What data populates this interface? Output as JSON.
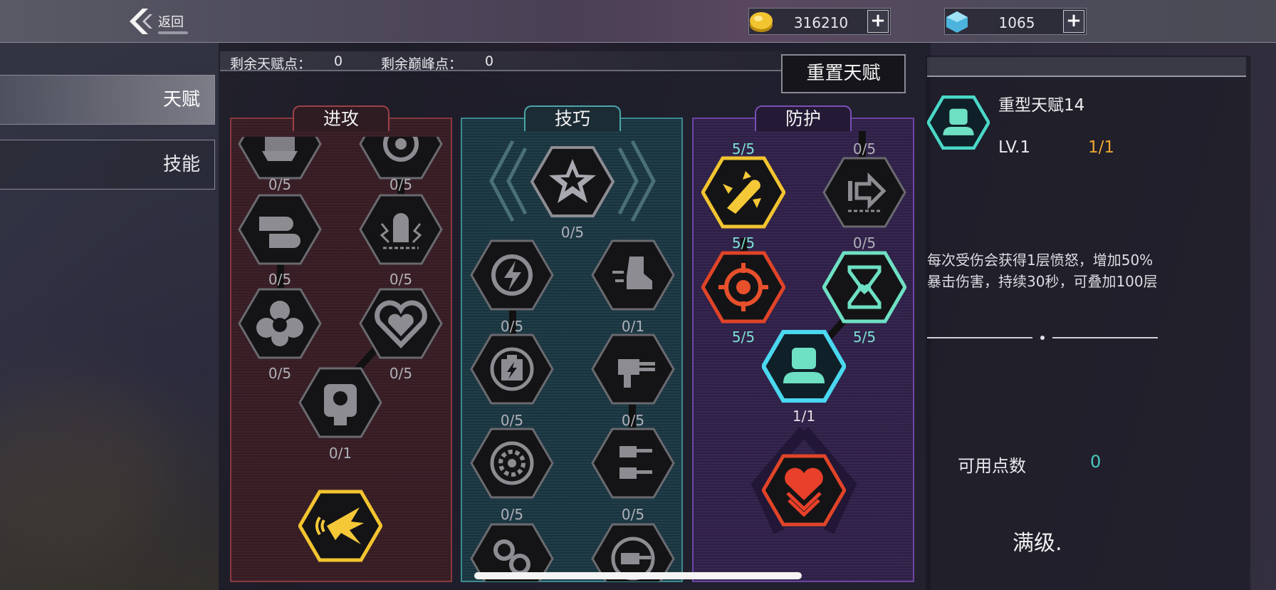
{
  "header": {
    "back_label": "返回",
    "gold": {
      "value": "316210",
      "plus": "+",
      "icon": "gold-coin-icon"
    },
    "gems": {
      "value": "1065",
      "plus": "+",
      "icon": "blue-gem-icon"
    }
  },
  "nav": {
    "items": [
      {
        "label": "天赋",
        "selected": true
      },
      {
        "label": "技能",
        "selected": false
      }
    ]
  },
  "points": {
    "talent_label": "剩余天赋点：",
    "talent_value": "0",
    "peak_label": "剩余巅峰点：",
    "peak_value": "0"
  },
  "reset_label": "重置天赋",
  "panels": {
    "attack": {
      "title": "进攻",
      "counts": [
        "0/5",
        "0/5",
        "0/5",
        "0/5",
        "0/5",
        "0/5",
        "0/1"
      ],
      "icons": [
        "rocket-pod-icon",
        "wheel-turret-icon",
        "twin-bullet-icon",
        "lightning-bullet-icon",
        "leaf-cluster-icon",
        "heart-shield-icon",
        "target-scope-icon",
        "burst-blast-icon"
      ]
    },
    "skill": {
      "title": "技巧",
      "counts": [
        "0/5",
        "0/5",
        "0/1",
        "0/5",
        "0/5",
        "0/5",
        "0/5"
      ],
      "icons": [
        "star-icon",
        "lightning-refresh-icon",
        "dash-boot-icon",
        "battery-refresh-icon",
        "gatling-gun-icon",
        "gear-shield-icon",
        "twin-cannon-icon",
        "gear-cluster-icon",
        "cannon-refresh-icon"
      ]
    },
    "defense": {
      "title": "防护",
      "counts": [
        "5/5",
        "0/5",
        "5/5",
        "0/5",
        "5/5",
        "5/5",
        "1/1"
      ],
      "icons": [
        "missile-burst-icon",
        "forward-arrow-icon",
        "crosshair-icon",
        "hourglass-heart-icon",
        "heavy-bust-icon",
        "layered-heart-icon"
      ]
    }
  },
  "info": {
    "name": "重型天赋14",
    "level": "LV.1",
    "progress": "1/1",
    "description": "每次受伤会获得1层愤怒，增加50%暴击伤害，持续30秒，可叠加100层",
    "available_label": "可用点数",
    "available_value": "0",
    "max_level": "满级."
  },
  "colors": {
    "orange": "#f0a830",
    "teal": "#4cc8c0",
    "attack": "#a04048",
    "skill": "#4aa6aa",
    "defense": "#7a50b6"
  }
}
